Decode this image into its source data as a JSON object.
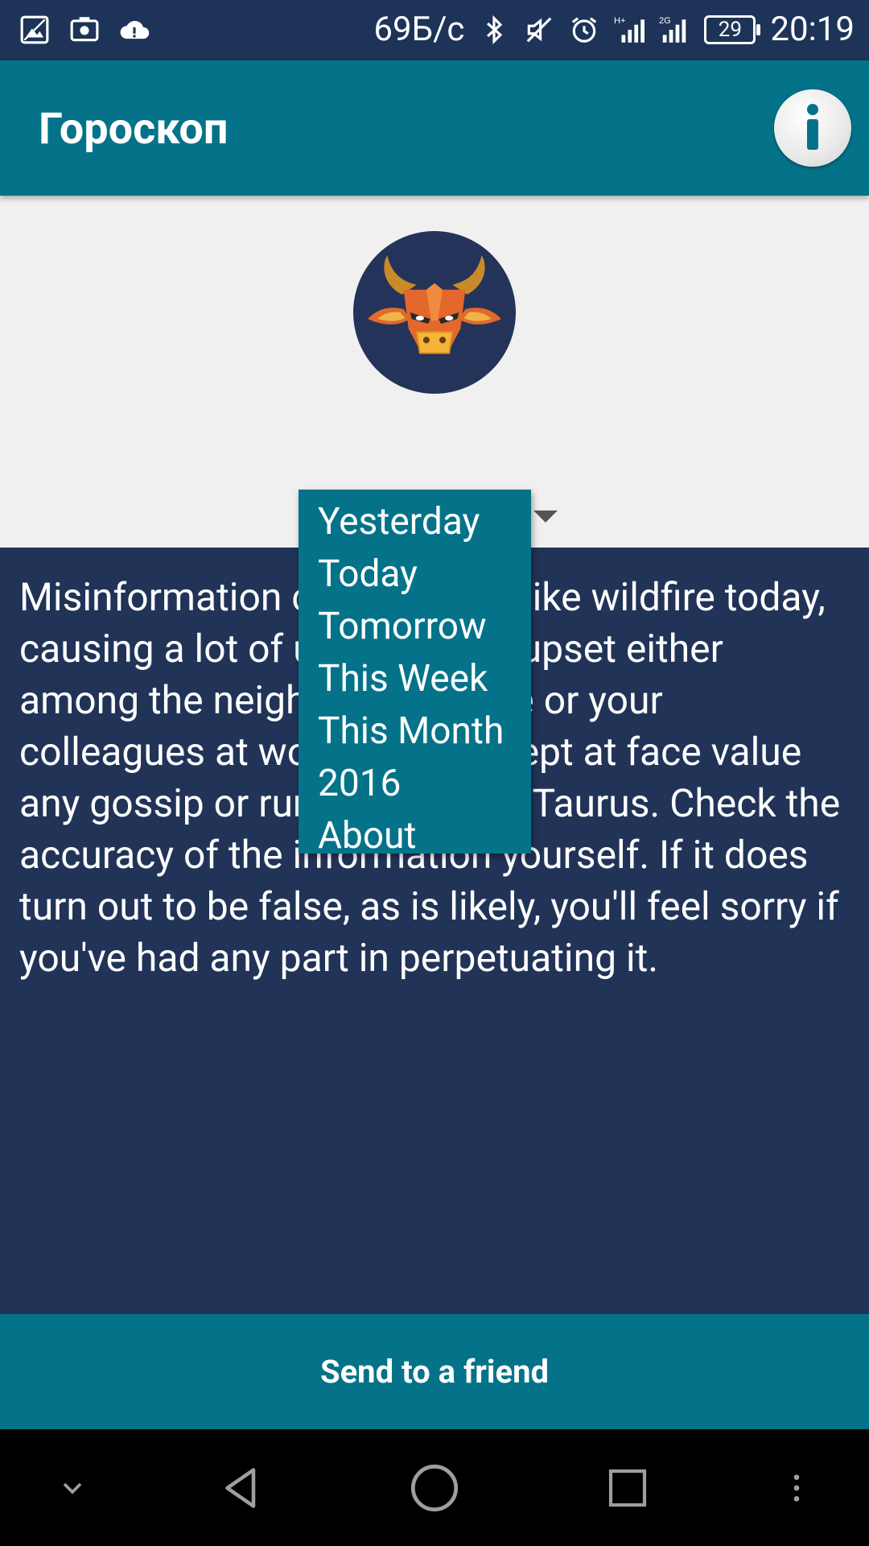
{
  "status_bar": {
    "network_speed": "69Б/с",
    "battery_level": "29",
    "time": "20:19",
    "icons": [
      "image-icon",
      "screenshot-icon",
      "cloud-alert-icon",
      "bluetooth-icon",
      "mute-icon",
      "alarm-icon",
      "signal-hplus-icon",
      "signal-2g-icon",
      "battery-icon"
    ]
  },
  "app_bar": {
    "title": "Гороскоп",
    "info_icon": "info-icon"
  },
  "zodiac": {
    "sign_icon": "taurus-bull-icon"
  },
  "period_menu": {
    "items": [
      "Yesterday",
      "Today",
      "Tomorrow",
      "This Week",
      "This Month",
      "2016",
      "About"
    ]
  },
  "horoscope": {
    "text": "Misinformation could spread like wildfire today, causing a lot of unnecessary upset either among the neighbors at home or your colleagues at work. Don't accept at face value any gossip or rumor you hear, Taurus. Check the accuracy of the information yourself. If it does turn out to be false, as is likely, you'll feel sorry if you've had any part in perpetuating it."
  },
  "actions": {
    "send_label": "Send to a friend"
  },
  "nav_bar": {
    "icons": [
      "chevron-down-icon",
      "back-icon",
      "home-icon",
      "recents-icon",
      "more-vert-icon"
    ]
  },
  "colors": {
    "status_bar": "#1d3357",
    "app_bar": "#047389",
    "panel": "#213357",
    "background": "#f0f0f0"
  }
}
